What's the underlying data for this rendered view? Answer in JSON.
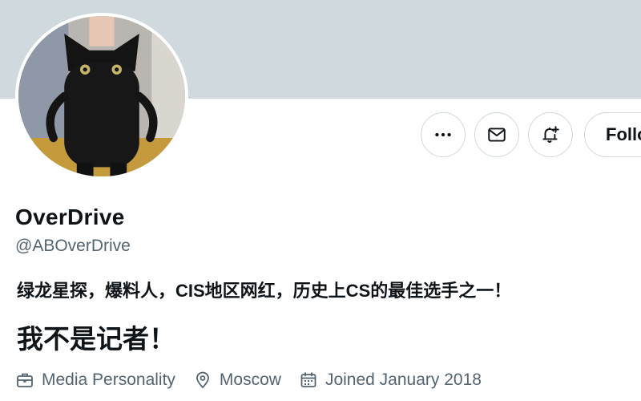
{
  "profile": {
    "display_name": "OverDrive",
    "handle": "@ABOverDrive",
    "bio_line1": "绿龙星探，爆料人，CIS地区网红，历史上CS的最佳选手之一！",
    "bio_line2": "我不是记者！",
    "avatar_icon": "black-cat-photo"
  },
  "actions": {
    "more_icon": "ellipsis-icon",
    "message_icon": "envelope-icon",
    "notify_icon": "bell-plus-icon",
    "follow_label": "Follo"
  },
  "meta": {
    "category": "Media Personality",
    "category_icon": "briefcase-icon",
    "location": "Moscow",
    "location_icon": "map-pin-icon",
    "joined": "Joined January 2018",
    "joined_icon": "calendar-icon"
  },
  "colors": {
    "banner": "#cfd9de",
    "text_primary": "#0f1419",
    "text_secondary": "#536471",
    "border": "#cfd9de"
  }
}
